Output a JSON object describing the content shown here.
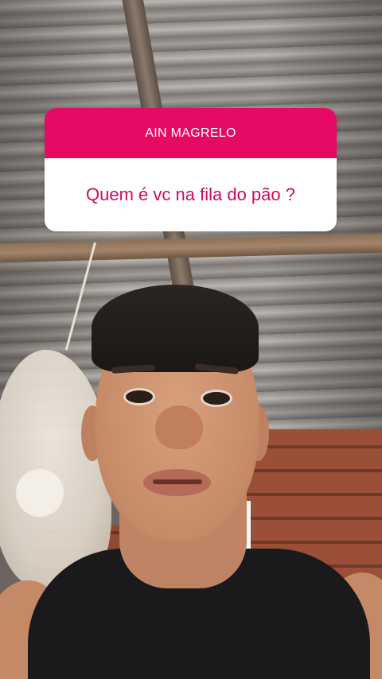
{
  "story": {
    "question_sticker": {
      "title": "AIN MAGRELO",
      "answer": "Quem é vc na fila do pão ?",
      "header_color": "#e60a65",
      "answer_color": "#d10a5d"
    },
    "background_photo": "selfie-video-frame"
  }
}
